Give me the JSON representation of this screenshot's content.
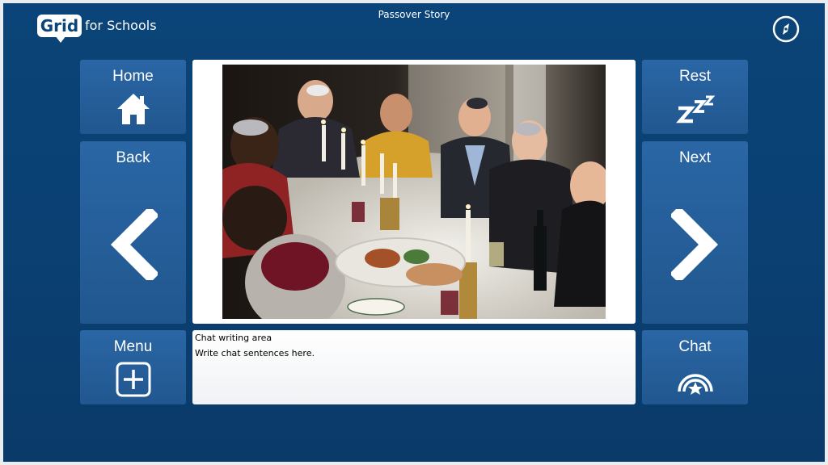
{
  "header": {
    "title": "Passover Story",
    "logo_text": "Grid",
    "logo_subtext": "for Schools"
  },
  "cells": {
    "home": {
      "label": "Home",
      "icon": "home-icon"
    },
    "back": {
      "label": "Back",
      "icon": "chevron-left-icon"
    },
    "menu": {
      "label": "Menu",
      "icon": "plus-square-icon"
    },
    "rest": {
      "label": "Rest",
      "icon": "zzz-icon"
    },
    "next": {
      "label": "Next",
      "icon": "chevron-right-icon"
    },
    "chat": {
      "label": "Chat",
      "icon": "chat-rainbow-icon"
    }
  },
  "chat_area": {
    "line1": "Chat writing area",
    "line2": "Write chat sentences here."
  },
  "colors": {
    "background": "#0b4478",
    "cell": "#2a66a5",
    "text": "#ffffff"
  }
}
